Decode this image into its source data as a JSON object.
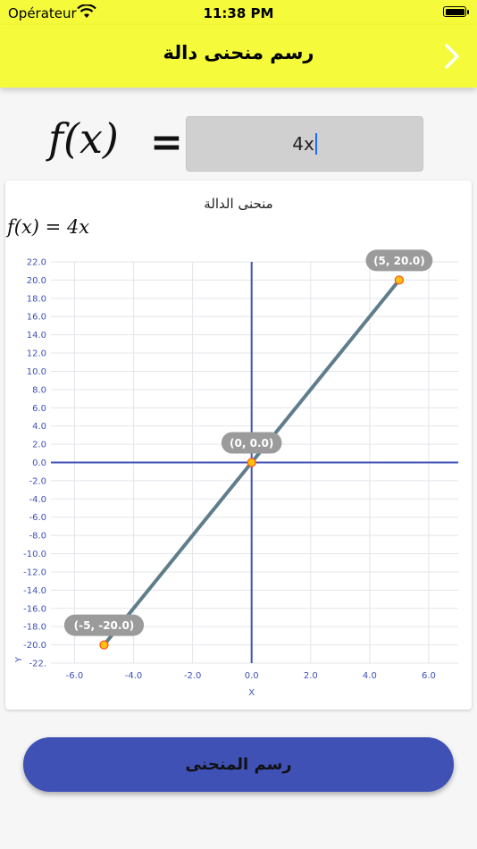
{
  "status_bar": {
    "carrier": "Opérateur",
    "time": "11:38 PM"
  },
  "nav": {
    "title": "رسم منحنى دالة",
    "forward_icon": "chevron-right-icon"
  },
  "function_input": {
    "label": "f(x)",
    "equals": "=",
    "value": "4x"
  },
  "chart_card": {
    "title": "منحنى الدالة",
    "formula_display": "f(x) = 4x"
  },
  "draw_button": {
    "label": "رسم المنحنى"
  },
  "colors": {
    "bar": "#f5fb3a",
    "button": "#3f51b5",
    "line": "#607d8b",
    "axis": "#3f51b5",
    "point_fill": "#ffc107",
    "point_stroke": "#ff5722"
  },
  "chart_data": {
    "type": "line",
    "title": "منحنى الدالة",
    "xlabel": "X",
    "ylabel": "Y",
    "xlim": [
      -6.8,
      7.0
    ],
    "ylim": [
      -22.0,
      22.0
    ],
    "x_ticks": [
      "-6.0",
      "-4.0",
      "-2.0",
      "0.0",
      "2.0",
      "4.0",
      "6.0"
    ],
    "y_ticks": [
      "22.0",
      "20.0",
      "18.0",
      "16.0",
      "14.0",
      "12.0",
      "10.0",
      "8.0",
      "6.0",
      "4.0",
      "2.0",
      "0.0",
      "-2.0",
      "-4.0",
      "-6.0",
      "-8.0",
      "-10.0",
      "-12.0",
      "-14.0",
      "-16.0",
      "-18.0",
      "-20.0",
      "-22."
    ],
    "grid": true,
    "series": [
      {
        "x": [
          -5,
          0,
          5
        ],
        "y": [
          -20.0,
          0.0,
          20.0
        ]
      }
    ],
    "annotations": [
      "(-5, -20.0)",
      "(0, 0.0)",
      "(5, 20.0)"
    ]
  }
}
